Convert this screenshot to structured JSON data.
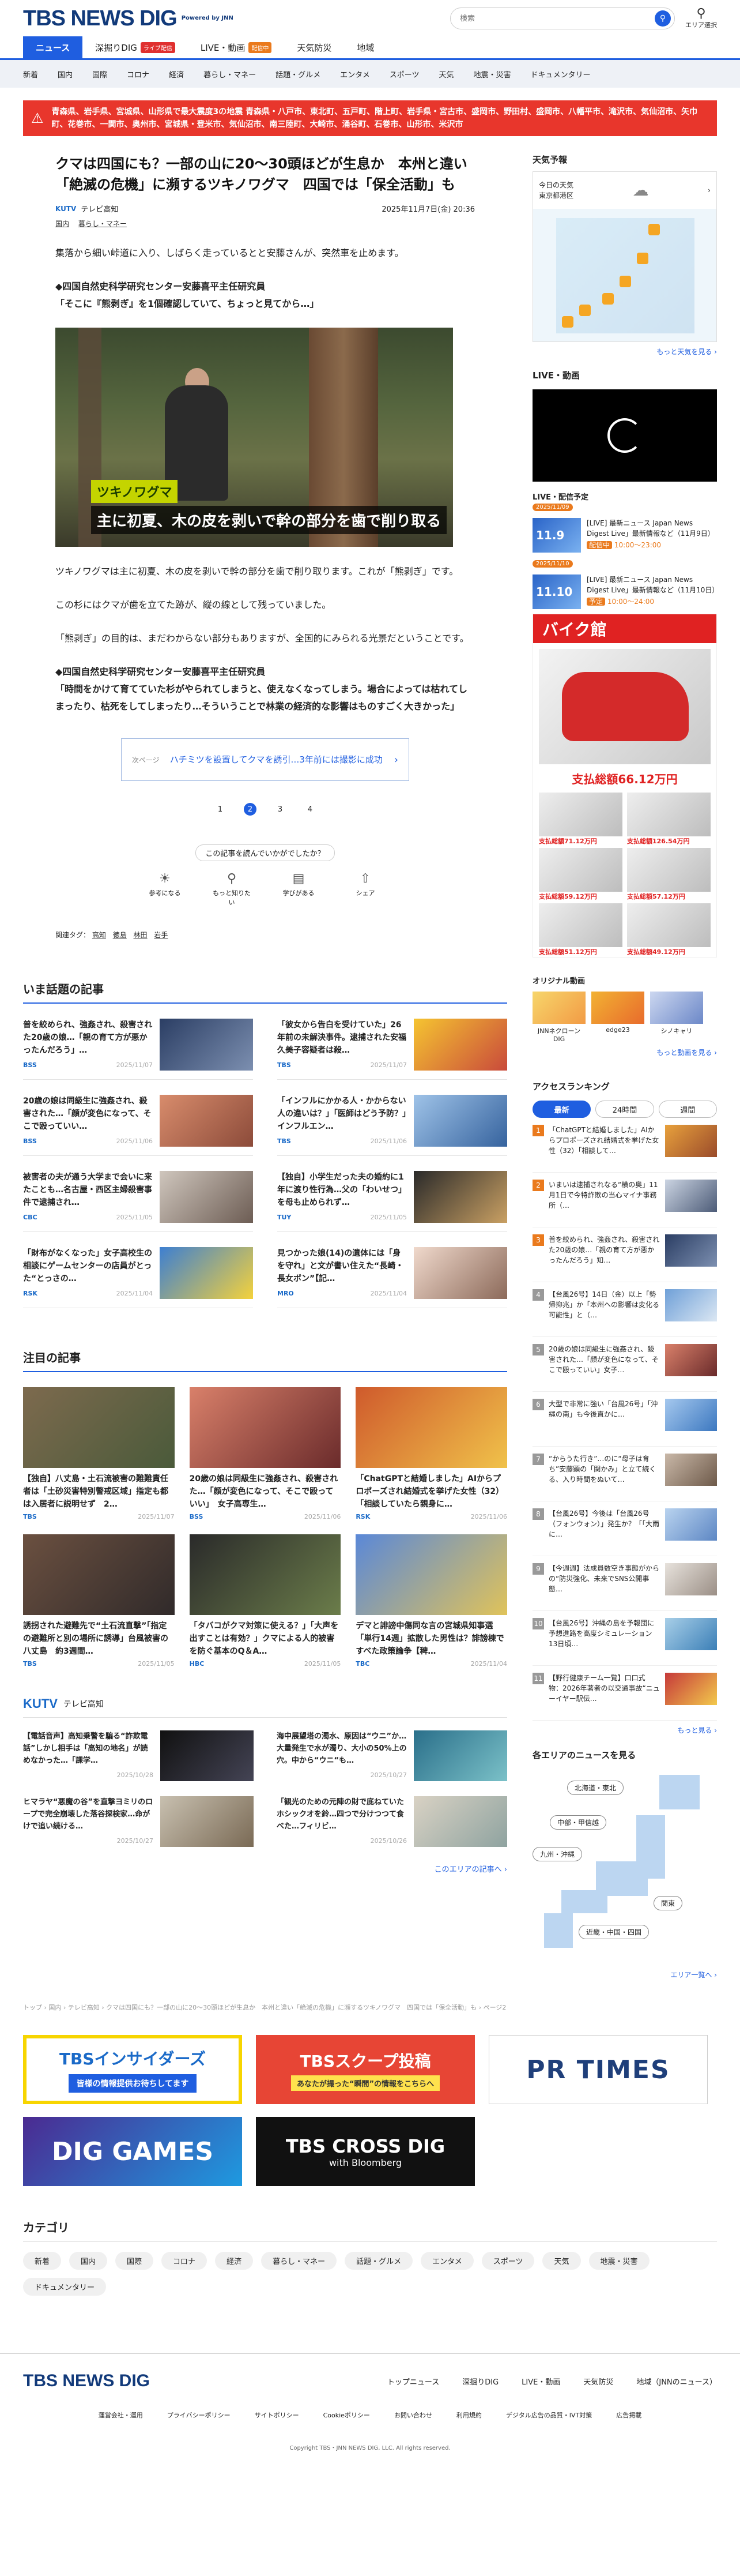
{
  "header": {
    "logo": "TBS NEWS DIG",
    "powered": "Powered by JNN",
    "search_placeholder": "検索",
    "area_label": "エリア選択"
  },
  "main_nav": [
    {
      "label": "ニュース",
      "badge": ""
    },
    {
      "label": "深掘りDIG",
      "badge": "ライブ配信"
    },
    {
      "label": "LIVE・動画",
      "badge": "配信中"
    },
    {
      "label": "天気防災",
      "badge": ""
    },
    {
      "label": "地域",
      "badge": ""
    }
  ],
  "sub_nav": [
    "新着",
    "国内",
    "国際",
    "コロナ",
    "経済",
    "暮らし・マネー",
    "話題・グルメ",
    "エンタメ",
    "スポーツ",
    "天気",
    "地震・災害",
    "ドキュメンタリー"
  ],
  "alert": {
    "text": "青森県、岩手県、宮城県、山形県で最大震度3の地震 青森県・八戸市、東北町、五戸町、階上町、岩手県・宮古市、盛岡市、野田村、盛岡市、八幡平市、滝沢市、気仙沼市、矢巾町、花巻市、一関市、奥州市、宮城県・登米市、気仙沼市、南三陸町、大崎市、涌谷町、石巻市、山形市、米沢市"
  },
  "article": {
    "title": "クマは四国にも？一部の山に20～30頭ほどが生息か　本州と違い「絶滅の危機」に瀕するツキノワグマ　四国では「保全活動」も",
    "datetime": "2025年11月7日(金) 20:36",
    "source": "テレビ高知",
    "source_short": "KUTV",
    "tags_label": "国内",
    "tags_sub": "暮らし・マネー",
    "p1": "集落から細い峠道に入り、しばらく走っているとと安藤さんが、突然車を止めます。",
    "p2a": "◆四国自然史科学研究センター安藤喜平主任研究員",
    "p2b": "「そこに『熊剥ぎ』を1個確認していて、ちょっと見てから…」",
    "photo_tag": "ツキノワグマ",
    "photo_caption": "主に初夏、木の皮を剥いで幹の部分を歯で削り取る",
    "p3": "ツキノワグマは主に初夏、木の皮を剥いで幹の部分を歯で削り取ります。これが「熊剥ぎ」です。",
    "p4": "この杉にはクマが歯を立てた跡が、縦の線として残っていました。",
    "p5": "「熊剥ぎ」の目的は、まだわからない部分もありますが、全国的にみられる光景だということです。",
    "p6a": "◆四国自然史科学研究センター安藤喜平主任研究員",
    "p6b": "「時間をかけて育てていた杉がやられてしまうと、使えなくなってしまう。場合によっては枯れてしまったり、枯死をしてしまったり…そういうことで林業の経済的な影響はものすごく大きかった」",
    "related_label": "次ページ",
    "related_text": "ハチミツを設置してクマを誘引…3年前には撮影に成功",
    "pages": [
      "1",
      "2",
      "3",
      "4"
    ],
    "current_page": "2",
    "feedback_q": "この記事を読んでいかがでしたか？",
    "feedback": [
      "参考になる",
      "もっと知りたい",
      "学びがある",
      "シェア"
    ],
    "related_tags_label": "関連タグ：",
    "related_tags": [
      "高知",
      "徳島",
      "林田",
      "岩手"
    ]
  },
  "topics": {
    "title": "いま話題の記事",
    "items": [
      {
        "text": "普を絞められ、強姦され、殺害された20歳の娘…「親の育て方が悪かったんだろう」…",
        "src": "BSS",
        "date": "2025/11/07"
      },
      {
        "text": "「彼女から告白を受けていた」26年前の未解決事件。逮捕された安福久美子容疑者は殺…",
        "src": "TBS",
        "date": "2025/11/07"
      },
      {
        "text": "20歳の娘は同級生に強姦され、殺害された…「顔が変色になって、そこで殴っていい…",
        "src": "BSS",
        "date": "2025/11/06"
      },
      {
        "text": "「インフルにかかる人・かからない人の違いは？」「医師はどう予防？」インフルエン…",
        "src": "TBS",
        "date": "2025/11/06"
      },
      {
        "text": "被害者の夫が通う大学まで会いに来たことも…名古屋・西区主婦殺害事件で逮捕され…",
        "src": "CBC",
        "date": "2025/11/05"
      },
      {
        "text": "【独自】小学生だった夫の婚約に1年に渡り性行為…父の「わいせつ」を母も止められず…",
        "src": "TUY",
        "date": "2025/11/05"
      },
      {
        "text": "「財布がなくなった」女子高校生の相談にゲームセンターの店員がとった“とっさの…",
        "src": "RSK",
        "date": "2025/11/04"
      },
      {
        "text": "見つかった娘(14)の遺体には「身を守れ」と文が書い住えた“長崎・長女ボン”【記…",
        "src": "MRO",
        "date": "2025/11/04"
      }
    ]
  },
  "featured": {
    "title": "注目の記事",
    "items": [
      {
        "text": "【独自】八丈島・土石流被害の難難責任者は「土砂災害特別警戒区域」指定も都は入居者に説明せず　2…",
        "src": "TBS",
        "date": "2025/11/07"
      },
      {
        "text": "20歳の娘は同級生に強姦され、殺害された…「顔が変色になって、そこで殴っていい」　女子高専生…",
        "src": "BSS",
        "date": "2025/11/06"
      },
      {
        "text": "「ChatGPTと結婚しました」AIからプロポーズされ結婚式を挙げた女性（32）「相談していたら親身に…",
        "src": "RSK",
        "date": "2025/11/06"
      },
      {
        "text": "誘拐された避難先で“土石流直撃”「指定の避難所と別の場所に誘導」台風被害の八丈島　約3週間…",
        "src": "TBS",
        "date": "2025/11/05"
      },
      {
        "text": "「タバコがクマ対策に使える？」「大声を出すことは有効？」クマによる人的被害を防ぐ基本のQ＆A…",
        "src": "HBC",
        "date": "2025/11/05"
      },
      {
        "text": "デマと誹謗中傷同な言の宮城県知事選「単行14週」拡散した男性は？誹謗棟ですべた政策論争【稗…",
        "src": "TBC",
        "date": "2025/11/04"
      }
    ]
  },
  "kutv": {
    "logo": "KUTV",
    "name": "テレビ高知",
    "items": [
      {
        "text": "【電話音声】高知乗警を騙る“詐欺電話”しかし相手は「高知の地名」が読めなかった…「課学…",
        "date": "2025/10/28"
      },
      {
        "text": "海中展望塔の濁水、原因は“ウニ”か…大量発生で水が濁り、大小の50%上の穴。中から“ウニ“も…",
        "date": "2025/10/27"
      },
      {
        "text": "ヒマラヤ“悪魔の谷”を直撃ヨミリのロープで完全崩壊した落谷探検家…命がけで追い続ける…",
        "date": "2025/10/27"
      },
      {
        "text": "「観光のための元陣の財で底ねていたホシックオを鈴…四つで分けつつて食べた…フィリビ…",
        "date": "2025/10/26"
      }
    ],
    "more": "このエリアの記事へ ›"
  },
  "breadcrumb": "トップ › 国内 › テレビ高知 › クマは四国にも？一部の山に20～30頭ほどが生息か　本州と違い「絶滅の危機」に瀕するツキノワグマ　四国では「保全活動」も › ページ2",
  "sidebar": {
    "weather_title": "天気予報",
    "weather_city_line1": "今日の天気",
    "weather_city_line2": "東京都港区",
    "weather_more": "もっと天気を見る ›",
    "live_title": "LIVE・動画",
    "live_sched_title": "LIVE・配信予定",
    "live_items": [
      {
        "date": "2025/11/09",
        "thumb": "11.9",
        "text": "[LIVE] 最新ニュース Japan News Digest Live」最新情報など（11月9日）",
        "time": "10:00～23:00",
        "label": "配信中"
      },
      {
        "date": "2025/11/10",
        "thumb": "11.10",
        "text": "[LIVE] 最新ニュース Japan News Digest Live」最新情報など（11月10日）",
        "time": "10:00～24:00",
        "label": "予定"
      }
    ],
    "ad_header": "バイク館",
    "ad_main_price": "支払総額66.12万円",
    "ad_prices": [
      "支払総額71.12万円",
      "支払総額126.54万円",
      "支払総額59.12万円",
      "支払総額57.12万円",
      "支払総額51.12万円",
      "支払総額49.12万円"
    ],
    "orig_title": "オリジナル動画",
    "orig_items": [
      "JNNネクローン DIG",
      "edge23",
      "シノキャリ"
    ],
    "orig_more": "もっと動画を見る ›",
    "rank_title": "アクセスランキング",
    "rank_tabs": [
      "最新",
      "24時間",
      "週間"
    ],
    "rank_items": [
      "「ChatGPTと結婚しました」AIからプロポーズされ結婚式を挙げた女性（32）「相談して…",
      "いまいは逮捕されなる“横の奥」11月1日で今特詐欺の当心マイナ事務所（…",
      "普を絞められ、強姦され、殺害された20歳の娘…「親の育て方が悪かったんだろう」知…",
      "【台風26号】14日（金）以上「勢帰抑兆」か「本州への影響は変化る可能性」と（…",
      "20歳の娘は同級生に強姦され、殺害された…「顔が変色になって、そこで殴っていい」女子…",
      "大型で非常に強い「台風26号」「沖縄の南」も今後直かに…",
      "“からうた行き”…のに“母子は育ち”安藤顕の「関かみ」と立て続くる、入り時間をぬいて…",
      "【台風26号】今後は「台風26号（フォンウォン）」発生か？「「大雨に…",
      "【今週週】法成員数空き事態がからの“防災強化、未来でSNS公開事態…",
      "【台風26号】沖縄の島を予報団に予想進路を高度シミュレーション13日頃…",
      "【野行健康チーム一覧】口口式 物：2026年著者の以交通事故“ニューイヤー駅伝…"
    ],
    "rank_more": "もっと見る ›",
    "area_title": "各エリアのニュースを見る",
    "area_pills": [
      "北海道・東北",
      "中部・甲信越",
      "九州・沖縄",
      "関東",
      "近畿・中国・四国"
    ],
    "area_more": "エリア一覧へ ›"
  },
  "banners": {
    "b1": "TBSインサイダーズ",
    "b1_sub": "皆様の情報提供お待ちしてます",
    "b2": "TBSスクープ投稿",
    "b2_sub": "あなたが撮った“瞬間”の情報をこちらへ",
    "b3": "PR TIMES",
    "b4": "DIG GAMES",
    "b5": "TBS CROSS DIG",
    "b5_sub": "with Bloomberg"
  },
  "category": {
    "title": "カテゴリ",
    "items": [
      "新着",
      "国内",
      "国際",
      "コロナ",
      "経済",
      "暮らし・マネー",
      "話題・グルメ",
      "エンタメ",
      "スポーツ",
      "天気",
      "地震・災害",
      "ドキュメンタリー"
    ]
  },
  "footer": {
    "logo": "TBS NEWS DIG",
    "nav": [
      "トップニュース",
      "深掘りDIG",
      "LIVE・動画",
      "天気防災",
      "地域（JNNのニュース）"
    ],
    "links": [
      "運営会社・運用",
      "プライバシーポリシー",
      "サイトポリシー",
      "Cookieポリシー",
      "お問い合わせ",
      "利用規約",
      "デジタル広告の品質・IVT対策",
      "広告掲載"
    ],
    "copyright": "Copyright TBS・JNN NEWS DIG, LLC. All rights reserved."
  }
}
